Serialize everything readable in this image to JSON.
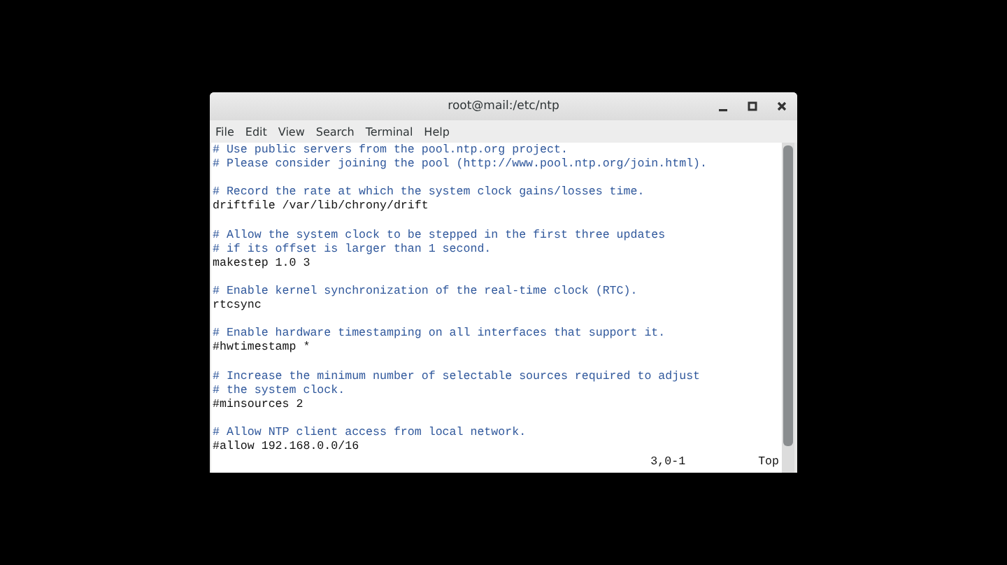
{
  "window": {
    "title": "root@mail:/etc/ntp"
  },
  "menu": [
    "File",
    "Edit",
    "View",
    "Search",
    "Terminal",
    "Help"
  ],
  "lines": [
    {
      "kind": "comment",
      "text": "# Use public servers from the pool.ntp.org project."
    },
    {
      "kind": "comment",
      "text": "# Please consider joining the pool (http://www.pool.ntp.org/join.html)."
    },
    {
      "kind": "blank"
    },
    {
      "kind": "comment",
      "text": "# Record the rate at which the system clock gains/losses time."
    },
    {
      "kind": "code",
      "text": "driftfile /var/lib/chrony/drift"
    },
    {
      "kind": "blank"
    },
    {
      "kind": "comment",
      "text": "# Allow the system clock to be stepped in the first three updates"
    },
    {
      "kind": "comment",
      "text": "# if its offset is larger than 1 second."
    },
    {
      "kind": "code",
      "text": "makestep 1.0 3"
    },
    {
      "kind": "blank"
    },
    {
      "kind": "comment",
      "text": "# Enable kernel synchronization of the real-time clock (RTC)."
    },
    {
      "kind": "code",
      "text": "rtcsync"
    },
    {
      "kind": "blank"
    },
    {
      "kind": "comment",
      "text": "# Enable hardware timestamping on all interfaces that support it."
    },
    {
      "kind": "code",
      "text": "#hwtimestamp *"
    },
    {
      "kind": "blank"
    },
    {
      "kind": "comment",
      "text": "# Increase the minimum number of selectable sources required to adjust"
    },
    {
      "kind": "comment",
      "text": "# the system clock."
    },
    {
      "kind": "code",
      "text": "#minsources 2"
    },
    {
      "kind": "blank"
    },
    {
      "kind": "comment",
      "text": "# Allow NTP client access from local network."
    },
    {
      "kind": "code",
      "text": "#allow 192.168.0.0/16"
    }
  ],
  "status": {
    "position": "3,0-1",
    "scroll": "Top"
  }
}
